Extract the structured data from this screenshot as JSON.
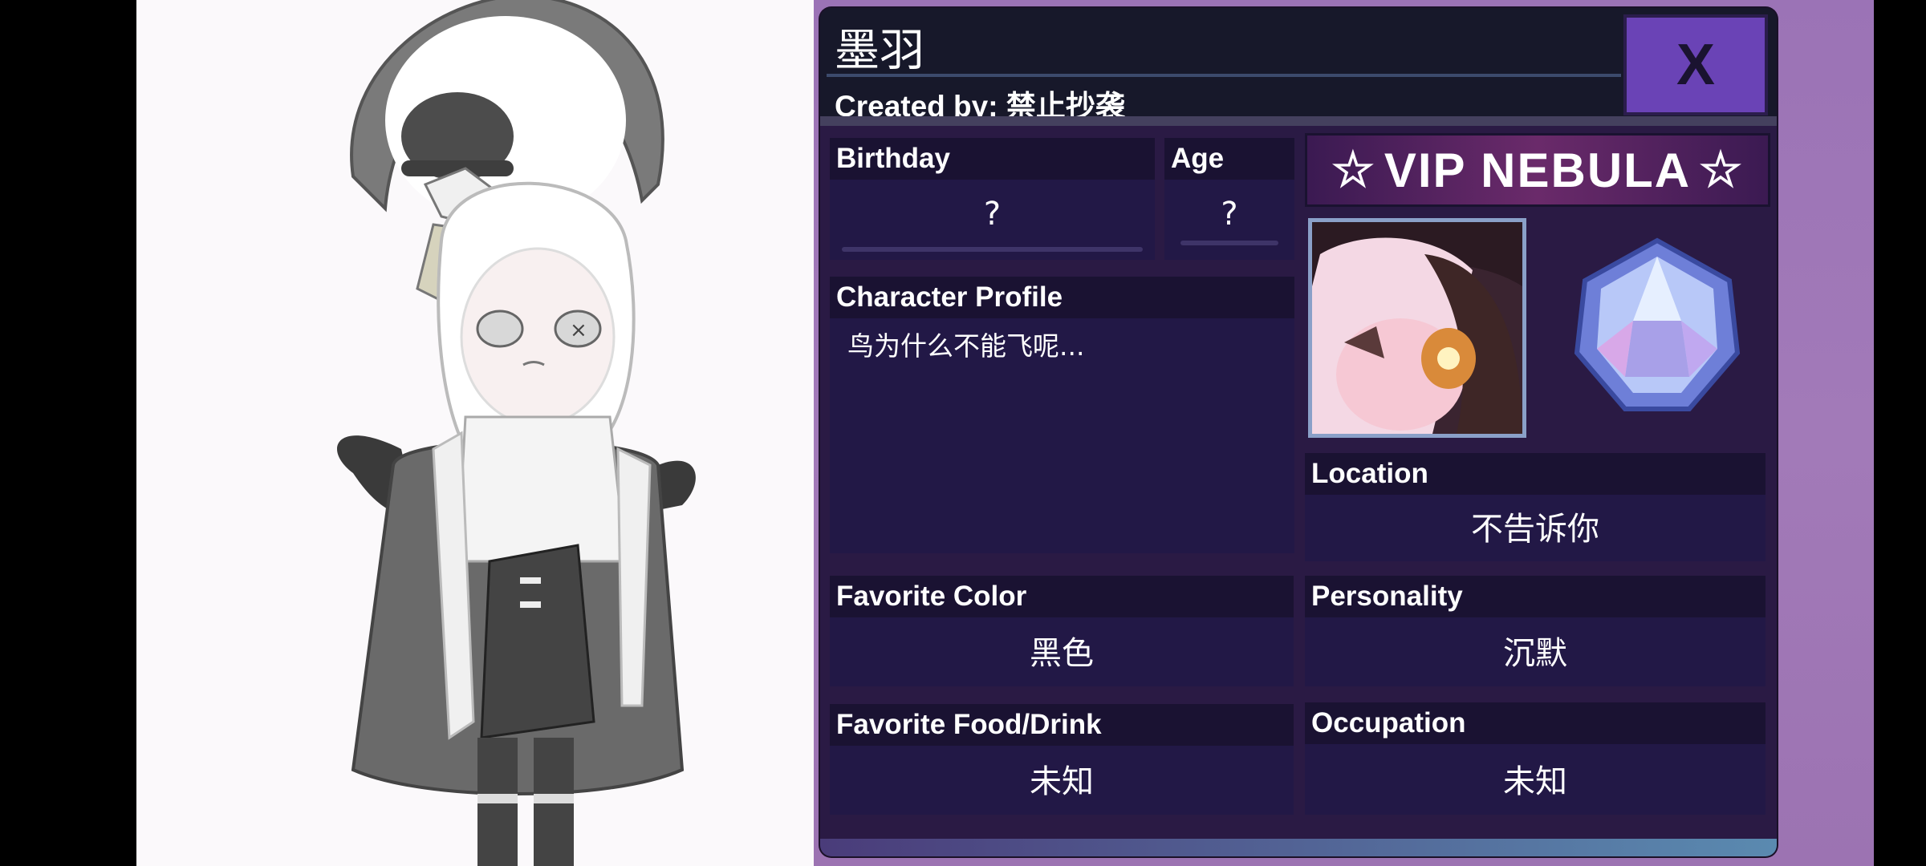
{
  "character": {
    "name": "墨羽",
    "created_by": "Created by: 禁止抄袭"
  },
  "close_button": {
    "label": "X"
  },
  "fields": {
    "birthday": {
      "label": "Birthday",
      "value": "?"
    },
    "age": {
      "label": "Age",
      "value": "?"
    },
    "profile": {
      "label": "Character Profile",
      "value": "鸟为什么不能飞呢..."
    },
    "location": {
      "label": "Location",
      "value": "不告诉你"
    },
    "favorite_color": {
      "label": "Favorite Color",
      "value": "黑色"
    },
    "personality": {
      "label": "Personality",
      "value": "沉默"
    },
    "favorite_food": {
      "label": "Favorite Food/Drink",
      "value": "未知"
    },
    "occupation": {
      "label": "Occupation",
      "value": "未知"
    }
  },
  "badge": {
    "vip_text": "VIP NEBULA"
  },
  "icons": [
    "close-icon",
    "avatar-portrait",
    "gem-icon",
    "star-icon"
  ],
  "colors": {
    "panel_bg": "#2a1a44",
    "card_bg": "#221846",
    "label_bg": "#1a1232",
    "close_button_bg": "#6a43b6",
    "right_bg": "#a27ab8"
  }
}
